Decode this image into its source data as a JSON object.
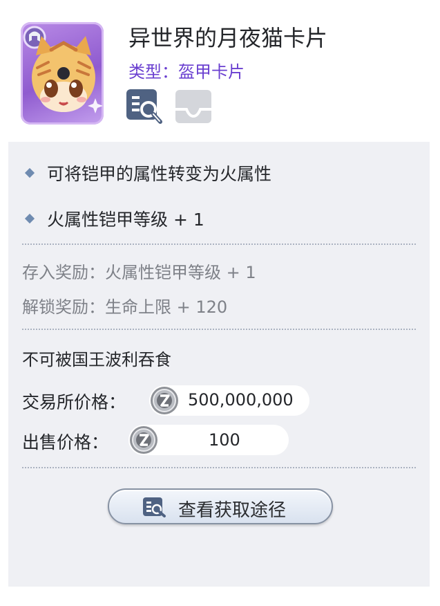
{
  "card": {
    "title": "异世界的月夜猫卡片",
    "type_label": "类型：盔甲卡片"
  },
  "effects": [
    "可将铠甲的属性转变为火属性",
    "火属性铠甲等级 + 1"
  ],
  "rewards": {
    "deposit": "存入奖励：火属性铠甲等级 + 1",
    "unlock": "解锁奖励：生命上限 + 120"
  },
  "notice": "不可被国王波利吞食",
  "prices": {
    "exchange_label": "交易所价格：",
    "exchange_value": "500,000,000",
    "sell_label": "出售价格：",
    "sell_value": "100"
  },
  "action": {
    "label": "查看获取途径"
  },
  "icons": {
    "view": "view-details-icon",
    "inbox": "inbox-icon",
    "coin": "zeny-coin-icon"
  },
  "colors": {
    "accent_purple": "#6a3fd0",
    "panel_bg": "#eff0f4",
    "card_frame": "#9c6ad9"
  }
}
